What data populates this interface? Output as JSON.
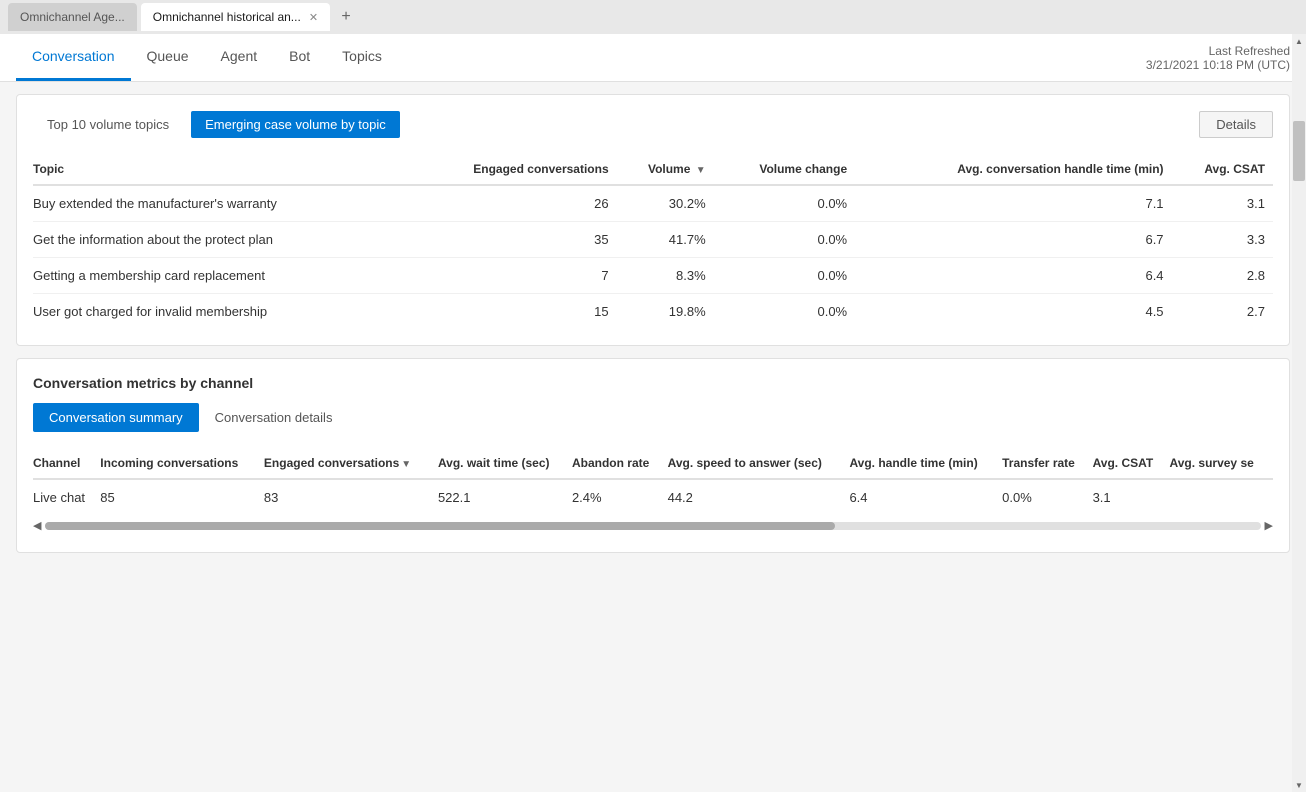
{
  "browser": {
    "tabs": [
      {
        "label": "Omnichannel Age...",
        "active": false
      },
      {
        "label": "Omnichannel historical an...",
        "active": true
      }
    ],
    "add_tab": "+"
  },
  "header": {
    "nav_tabs": [
      {
        "label": "Conversation",
        "active": true
      },
      {
        "label": "Queue",
        "active": false
      },
      {
        "label": "Agent",
        "active": false
      },
      {
        "label": "Bot",
        "active": false
      },
      {
        "label": "Topics",
        "active": false
      }
    ],
    "last_refreshed_label": "Last Refreshed",
    "last_refreshed_value": "3/21/2021 10:18 PM (UTC)"
  },
  "topics_section": {
    "tab_inactive": "Top 10 volume topics",
    "tab_active": "Emerging case volume by topic",
    "details_btn": "Details",
    "columns": [
      {
        "label": "Topic",
        "align": "left"
      },
      {
        "label": "Engaged conversations",
        "align": "right"
      },
      {
        "label": "Volume",
        "align": "right",
        "sort": true
      },
      {
        "label": "Volume change",
        "align": "right"
      },
      {
        "label": "Avg. conversation handle time (min)",
        "align": "right"
      },
      {
        "label": "Avg. CSAT",
        "align": "right"
      }
    ],
    "rows": [
      {
        "topic": "Buy extended the manufacturer's warranty",
        "engaged": "26",
        "volume": "30.2%",
        "volume_change": "0.0%",
        "avg_handle": "7.1",
        "avg_csat": "3.1"
      },
      {
        "topic": "Get the information about the protect plan",
        "engaged": "35",
        "volume": "41.7%",
        "volume_change": "0.0%",
        "avg_handle": "6.7",
        "avg_csat": "3.3"
      },
      {
        "topic": "Getting a membership card replacement",
        "engaged": "7",
        "volume": "8.3%",
        "volume_change": "0.0%",
        "avg_handle": "6.4",
        "avg_csat": "2.8"
      },
      {
        "topic": "User got charged for invalid membership",
        "engaged": "15",
        "volume": "19.8%",
        "volume_change": "0.0%",
        "avg_handle": "4.5",
        "avg_csat": "2.7"
      }
    ]
  },
  "metrics_section": {
    "section_title": "Conversation metrics by channel",
    "sub_tab_active": "Conversation summary",
    "sub_tab_inactive": "Conversation details",
    "columns": [
      {
        "label": "Channel"
      },
      {
        "label": "Incoming conversations"
      },
      {
        "label": "Engaged conversations",
        "sort": true
      },
      {
        "label": "Avg. wait time (sec)"
      },
      {
        "label": "Abandon rate"
      },
      {
        "label": "Avg. speed to answer (sec)"
      },
      {
        "label": "Avg. handle time (min)"
      },
      {
        "label": "Transfer rate"
      },
      {
        "label": "Avg. CSAT"
      },
      {
        "label": "Avg. survey se"
      }
    ],
    "rows": [
      {
        "channel": "Live chat",
        "incoming": "85",
        "engaged": "83",
        "avg_wait": "522.1",
        "abandon_rate": "2.4%",
        "avg_speed": "44.2",
        "avg_handle": "6.4",
        "transfer_rate": "0.0%",
        "avg_csat": "3.1",
        "avg_survey": ""
      }
    ]
  }
}
